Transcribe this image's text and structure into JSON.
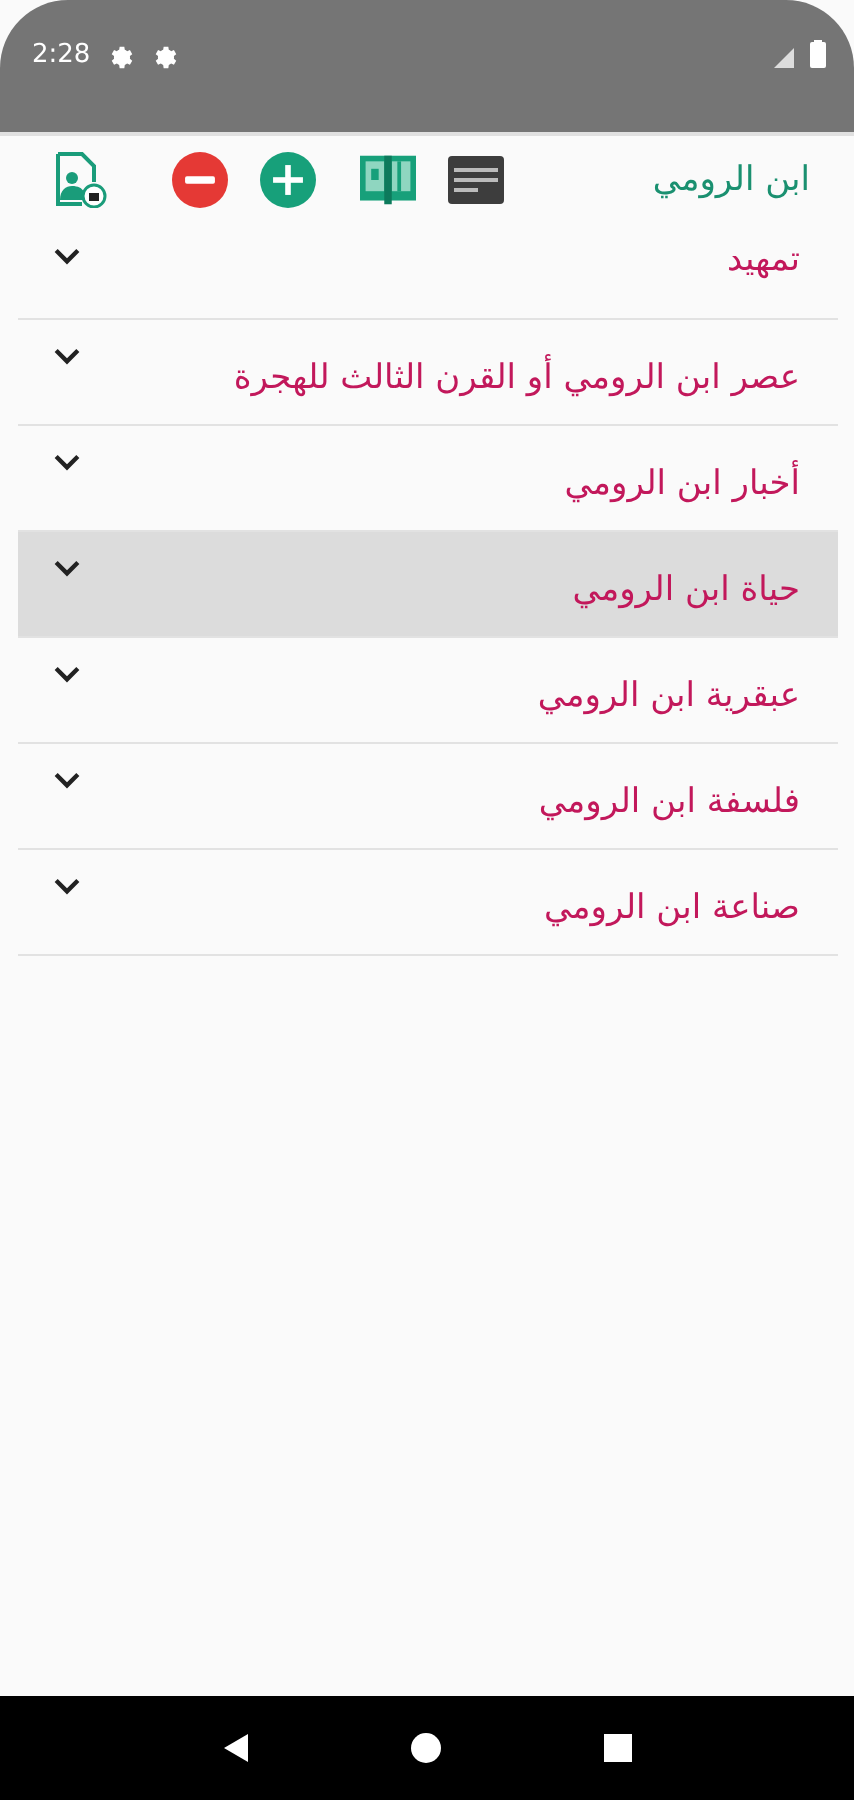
{
  "status_bar": {
    "time": "2:28"
  },
  "toolbar": {
    "title": "ابن الرومي"
  },
  "items": [
    {
      "label": "تمهيد",
      "selected": false,
      "expanded": false
    },
    {
      "label": "عصر ابن الرومي أو القرن الثالث للهجرة",
      "selected": false,
      "expanded": false
    },
    {
      "label": "أخبار ابن الرومي",
      "selected": false,
      "expanded": false
    },
    {
      "label": "حياة ابن الرومي",
      "selected": true,
      "expanded": false
    },
    {
      "label": "عبقرية ابن الرومي",
      "selected": false,
      "expanded": false
    },
    {
      "label": "فلسفة ابن الرومي",
      "selected": false,
      "expanded": false
    },
    {
      "label": "صناعة ابن الرومي",
      "selected": false,
      "expanded": false
    }
  ]
}
